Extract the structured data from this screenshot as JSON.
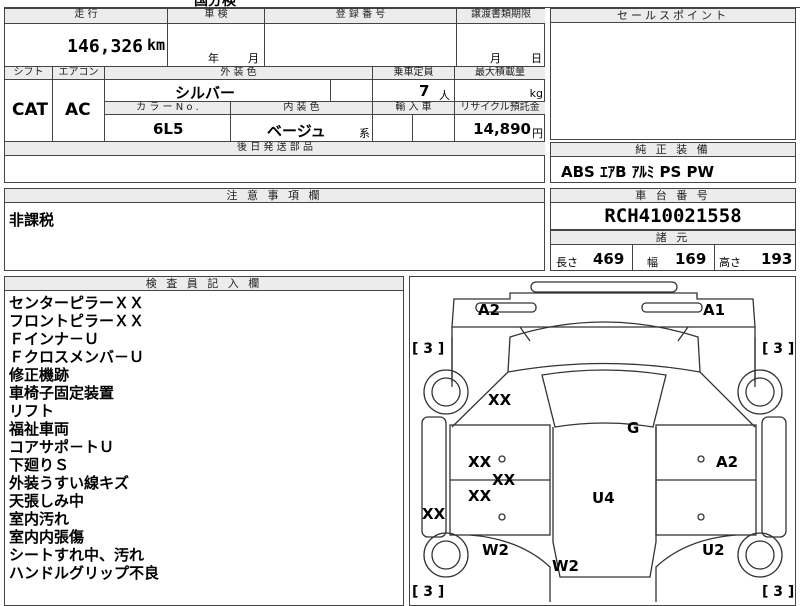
{
  "top_strip": {
    "partial_text": "国分検"
  },
  "summary": {
    "mileage_header": "走 行",
    "mileage_value": "146,326",
    "mileage_unit": "km",
    "inspection_header": "車 検",
    "inspection_year": "年",
    "inspection_month": "月",
    "registration_header": "登 録 番 号",
    "transfer_header": "譲渡書類期限",
    "transfer_month": "月",
    "transfer_day": "日",
    "shift_header": "シフト",
    "shift_value": "CAT",
    "ac_header": "エアコン",
    "ac_value": "AC",
    "exterior_header": "外 装 色",
    "exterior_value": "シルバー",
    "capacity_header": "乗車定員",
    "capacity_value": "7",
    "capacity_unit": "人",
    "load_header": "最大積載量",
    "load_unit": "kg",
    "color_no_header": "カ ラ ー N o .",
    "color_no_value": "6L5",
    "interior_header": "内 装 色",
    "interior_value": "ベージュ",
    "interior_suffix": "系",
    "import_header": "輸 入 車",
    "recycle_header": "リサイクル預託金",
    "recycle_value": "14,890",
    "recycle_unit": "円",
    "later_parts_header": "後 日 発 送 部 品"
  },
  "sales_point": {
    "header": "セールスポイント"
  },
  "equipment": {
    "header": "純 正 装 備",
    "value": "ABS ｴｱB ｱﾙﾐ PS PW"
  },
  "notes": {
    "header": "注 意 事 項 欄",
    "value": "非課税"
  },
  "chassis": {
    "header": "車 台 番 号",
    "value": "RCH410021558"
  },
  "specs": {
    "header": "諸 元",
    "length_label": "長さ",
    "length_value": "469",
    "width_label": "幅",
    "width_value": "169",
    "height_label": "高さ",
    "height_value": "193"
  },
  "inspector": {
    "header": "検 査 員 記 入 欄",
    "remarks": [
      "センターピラーＸＸ",
      "フロントピラーＸＸ",
      "Ｆインナ－Ｕ",
      "Ｆクロスメンバ－Ｕ",
      "修正機跡",
      "車椅子固定装置",
      "リフト",
      "福祉車両",
      "コアサポ－トＵ",
      "下廻りＳ",
      "外装うすい線キズ",
      "天張しみ中",
      "室内汚れ",
      "室内内張傷",
      "シートすれ中、汚れ",
      "ハンドルグリップ不良"
    ]
  },
  "diagram": {
    "labels": [
      "A2",
      "A1",
      "[ 3 ]",
      "[ 3 ]",
      "XX",
      "G",
      "XX",
      "XX",
      "A2",
      "XX",
      "U4",
      "XX",
      "W2",
      "U2",
      "W2",
      "[ 3 ]",
      "[ 3 ]"
    ]
  }
}
